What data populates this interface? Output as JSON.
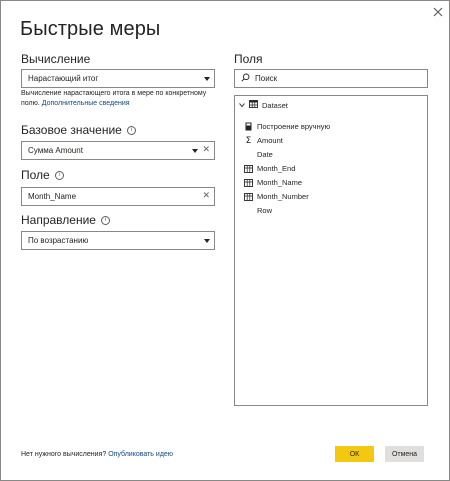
{
  "dialog": {
    "title": "Быстрые меры",
    "close_icon": "close-icon"
  },
  "calculation": {
    "label": "Вычисление",
    "value": "Нарастающий итог",
    "description": "Вычисление нарастающего итога в мере по конкретному полю.",
    "more_link": "Дополнительные сведения"
  },
  "base_value": {
    "label": "Базовое значение",
    "value": "Сумма Amount"
  },
  "field": {
    "label": "Поле",
    "value": "Month_Name"
  },
  "direction": {
    "label": "Направление",
    "value": "По возрастанию"
  },
  "fields_panel": {
    "label": "Поля",
    "search_placeholder": "Поиск",
    "root": "Dataset",
    "items": [
      {
        "label": "Построение вручную",
        "icon": "calculator-icon"
      },
      {
        "label": "Amount",
        "icon": "sigma-icon"
      },
      {
        "label": "Date",
        "icon": ""
      },
      {
        "label": "Month_End",
        "icon": "hierarchy-icon"
      },
      {
        "label": "Month_Name",
        "icon": "hierarchy-icon"
      },
      {
        "label": "Month_Number",
        "icon": "hierarchy-icon"
      },
      {
        "label": "Row",
        "icon": ""
      }
    ]
  },
  "footer": {
    "question": "Нет нужного вычисления?",
    "publish_link": "Опубликовать идею",
    "ok_label": "ОК",
    "cancel_label": "Отмена"
  },
  "colors": {
    "accent_button": "#f2c811",
    "link": "#0f4a85",
    "border": "#8a8886"
  }
}
